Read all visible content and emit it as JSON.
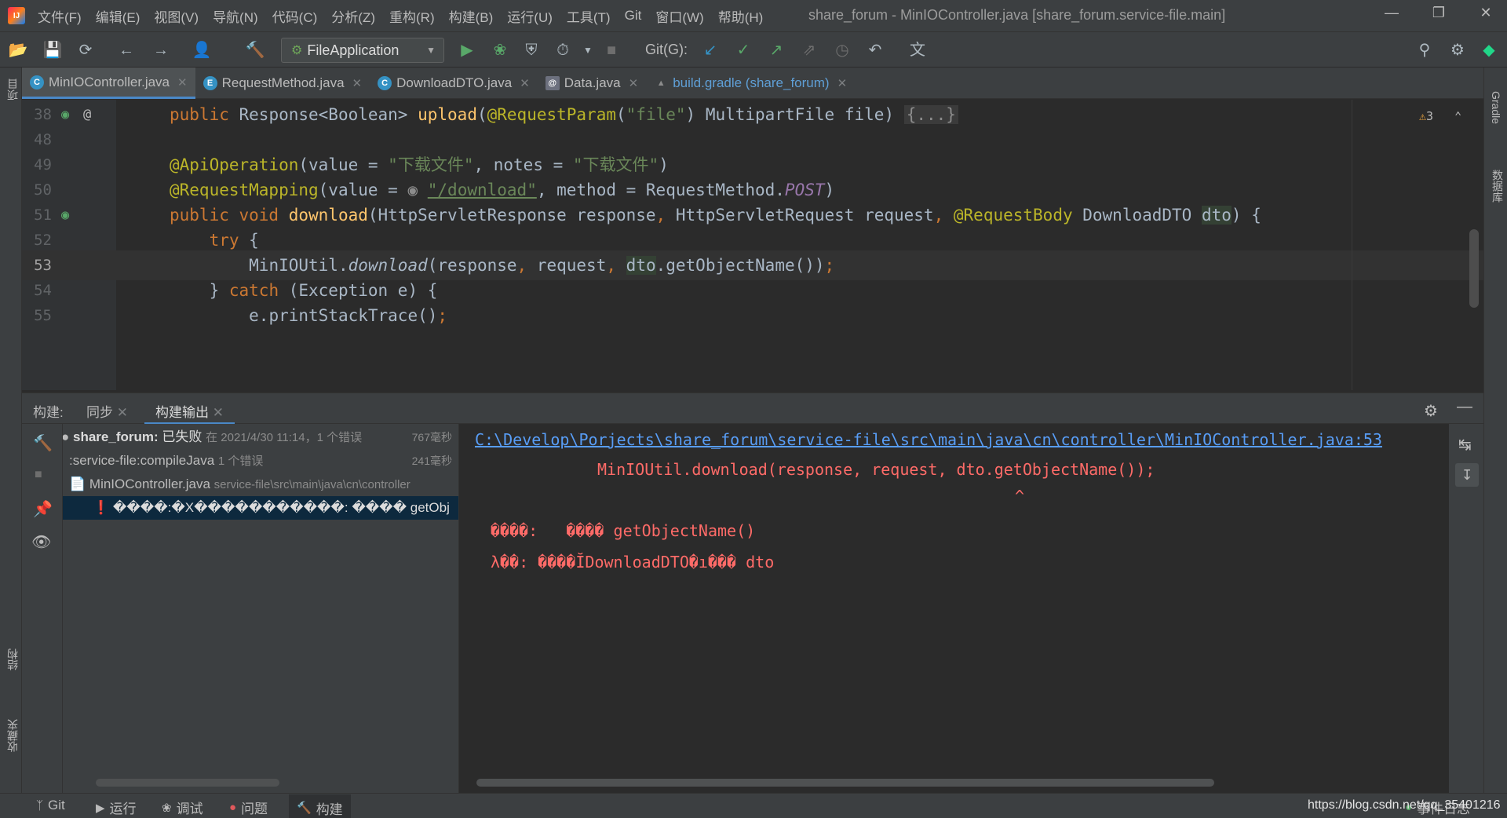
{
  "app": {
    "logo_text": "IJ",
    "window_title": "share_forum - MinIOController.java [share_forum.service-file.main]"
  },
  "menu": [
    "文件(F)",
    "编辑(E)",
    "视图(V)",
    "导航(N)",
    "代码(C)",
    "分析(Z)",
    "重构(R)",
    "构建(B)",
    "运行(U)",
    "工具(T)",
    "Git",
    "窗口(W)",
    "帮助(H)"
  ],
  "toolbar": {
    "run_config": "FileApplication",
    "git_label": "Git(G):"
  },
  "left_strip": {
    "project": "项目",
    "structure": "结构",
    "favorites": "收藏夹"
  },
  "right_strip": {
    "gradle": "Gradle",
    "database": "数据库"
  },
  "tabs": [
    {
      "label": "MinIOController.java",
      "icon": "C",
      "active": true
    },
    {
      "label": "RequestMethod.java",
      "icon": "E",
      "active": false
    },
    {
      "label": "DownloadDTO.java",
      "icon": "C",
      "active": false
    },
    {
      "label": "Data.java",
      "icon": "@",
      "active": false
    },
    {
      "label": "build.gradle (share_forum)",
      "icon": "gradle",
      "active": false
    }
  ],
  "editor": {
    "warning_count": "3",
    "lines": [
      {
        "num": "38"
      },
      {
        "num": "48"
      },
      {
        "num": "49"
      },
      {
        "num": "50"
      },
      {
        "num": "51"
      },
      {
        "num": "52"
      },
      {
        "num": "53"
      },
      {
        "num": "54"
      },
      {
        "num": "55"
      }
    ],
    "code": {
      "l38": {
        "kw": "public",
        "type": "Response<Boolean>",
        "fn": "upload",
        "ann": "@RequestParam",
        "str": "\"file\"",
        "rest": " MultipartFile file)",
        "fold": "{...}"
      },
      "l49": {
        "ann": "@ApiOperation",
        "a1": "(value = ",
        "s1": "\"下载文件\"",
        "a2": ", notes = ",
        "s2": "\"下载文件\"",
        "a3": ")"
      },
      "l50": {
        "ann": "@RequestMapping",
        "a1": "(value = ",
        "s1": "\"/download\"",
        "a2": ", method = RequestMethod.",
        "c1": "POST",
        "a3": ")"
      },
      "l51": {
        "kw": "public void",
        "fn": "download",
        "p1": "(HttpServletResponse response",
        "p2": " HttpServletRequest request",
        "ann": "@RequestBody",
        "p3": " DownloadDTO ",
        "p4": "dto",
        "p5": ") {"
      },
      "l52": {
        "kw": "try",
        "rest": " {"
      },
      "l53": {
        "cls": "MinIOUtil.",
        "fn": "download",
        "p1": "(response",
        "p2": " request",
        "p3": "dto",
        "p4": ".getObjectName())"
      },
      "l54": {
        "a1": "} ",
        "kw": "catch",
        "a2": " (Exception e) {"
      },
      "l55": {
        "a1": "e.printStackTrace()"
      }
    }
  },
  "build": {
    "header_label": "构建:",
    "tab_sync": "同步",
    "tab_output": "构建输出",
    "tree": {
      "r1_name": "share_forum:",
      "r1_status": "已失败",
      "r1_detail": "在 2021/4/30 11:14，1 个错误",
      "r1_ms": "767毫秒",
      "r2_name": ":service-file:compileJava",
      "r2_detail": "1 个错误",
      "r2_ms": "241毫秒",
      "r3_name": "MinIOController.java",
      "r3_path": "service-file\\src\\main\\java\\cn\\controller",
      "r4_text": "����:�X�����������:  ���� getObj"
    },
    "console": {
      "link": "C:\\Develop\\Porjects\\share_forum\\service-file\\src\\main\\java\\cn\\controller\\MinIOController.java:53",
      "line2": "MinIOUtil.download(response, request, dto.getObjectName());",
      "caret": "^",
      "line4": "����:   ���� getObjectName()",
      "line5": "λ��: ����ĬDownloadDTO�ı��� dto"
    }
  },
  "statusbar": {
    "git": "Git",
    "run": "运行",
    "debug": "调试",
    "problems": "问题",
    "build": "构建",
    "event_log": "事件日志",
    "watermark": "https://blog.csdn.net/qq_35401216"
  }
}
